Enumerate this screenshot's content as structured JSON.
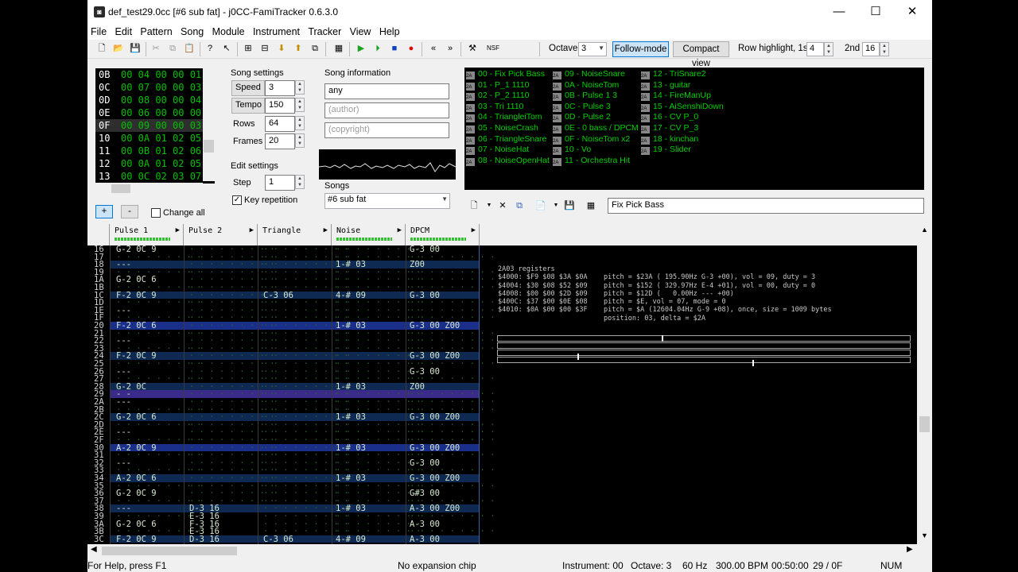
{
  "window": {
    "title": "def_test29.0cc [#6 sub fat] - j0CC-FamiTracker 0.6.3.0"
  },
  "menu": [
    "File",
    "Edit",
    "Pattern",
    "Song",
    "Module",
    "Instrument",
    "Tracker",
    "View",
    "Help"
  ],
  "toolbar": {
    "octave_label": "Octave",
    "octave_value": "3",
    "follow_mode": "Follow-mode",
    "compact_view": "Compact view",
    "row_highlight_label": "Row highlight, 1st",
    "row_highlight_1st": "4",
    "second_label": "2nd",
    "row_highlight_2nd": "16",
    "nsf_label": "NSF"
  },
  "frames": {
    "rows": [
      [
        "0B",
        "00 04 00 00 01"
      ],
      [
        "0C",
        "00 07 00 00 03"
      ],
      [
        "0D",
        "00 08 00 00 04"
      ],
      [
        "0E",
        "00 06 00 00 00"
      ],
      [
        "0F",
        "00 09 00 00 03"
      ],
      [
        "10",
        "00 0A 01 02 05"
      ],
      [
        "11",
        "00 0B 01 02 06"
      ],
      [
        "12",
        "00 0A 01 02 05"
      ],
      [
        "13",
        "00 0C 02 03 07"
      ]
    ],
    "add": "+",
    "remove": "-",
    "change_all": "Change all"
  },
  "song_settings": {
    "title": "Song settings",
    "speed_label": "Speed",
    "speed": "3",
    "tempo_label": "Tempo",
    "tempo": "150",
    "rows_label": "Rows",
    "rows": "64",
    "frames_label": "Frames",
    "frames": "20"
  },
  "edit_settings": {
    "title": "Edit settings",
    "step_label": "Step",
    "step": "1",
    "key_repetition": "Key repetition"
  },
  "song_info": {
    "title": "Song information",
    "name": "any",
    "author_placeholder": "(author)",
    "copyright_placeholder": "(copyright)"
  },
  "songs": {
    "label": "Songs",
    "selected": "#6 sub fat"
  },
  "instruments": {
    "col1": [
      "00 - Fix Pick Bass",
      "01 - P_1 1110",
      "02 - P_2 1110",
      "03 - Tri 1110",
      "04 - TriangleiTom",
      "05 - NoiseCrash",
      "06 - TriangleSnare",
      "07 - NoiseHat",
      "08 - NoiseOpenHat"
    ],
    "col2": [
      "09 - NoiseSnare",
      "0A - NoiseTom",
      "0B - Pulse 1 3",
      "0C - Pulse 3",
      "0D - Pulse 2",
      "0E - 0 bass / DPCM",
      "0F - NoiseTom x2",
      "10 - Vo",
      "11 - Orchestra Hit"
    ],
    "col3": [
      "12 - TriSnare2",
      "13 - guitar",
      "14 - FireManUp",
      "15 - AiSenshiDown",
      "16 - CV P_0",
      "17 - CV P_3",
      "18 - kinchan",
      "19 - Slider"
    ],
    "name_field": "Fix Pick Bass"
  },
  "channels": [
    "Pulse 1",
    "Pulse 2",
    "Triangle",
    "Noise",
    "DPCM"
  ],
  "pattern_rows": [
    [
      "16",
      "G-2 0C 9",
      "",
      "",
      "",
      "G-3 00"
    ],
    [
      "17",
      "",
      "",
      "",
      "",
      ""
    ],
    [
      "18",
      "---",
      "",
      "",
      "1-# 03",
      "Z00"
    ],
    [
      "19",
      "",
      "",
      "",
      "",
      ""
    ],
    [
      "1A",
      "G-2 0C 6",
      "",
      "",
      "",
      ""
    ],
    [
      "1B",
      "",
      "",
      "",
      "",
      ""
    ],
    [
      "1C",
      "F-2 0C 9",
      "",
      "C-3 06",
      "4-# 09",
      "G-3 00"
    ],
    [
      "1D",
      "",
      "",
      "",
      "",
      ""
    ],
    [
      "1E",
      "---",
      "",
      "",
      "",
      ""
    ],
    [
      "1F",
      "",
      "",
      "",
      "",
      ""
    ],
    [
      "20",
      "F-2 0C 6",
      "",
      "",
      "1-# 03",
      "G-3 00 Z00"
    ],
    [
      "21",
      "",
      "",
      "",
      "",
      ""
    ],
    [
      "22",
      "---",
      "",
      "",
      "",
      ""
    ],
    [
      "23",
      "",
      "",
      "",
      "",
      ""
    ],
    [
      "24",
      "F-2 0C 9",
      "",
      "",
      "",
      "G-3 00 Z00"
    ],
    [
      "25",
      "",
      "",
      "",
      "",
      ""
    ],
    [
      "26",
      "---",
      "",
      "",
      "",
      "G-3 00"
    ],
    [
      "27",
      "",
      "",
      "",
      "",
      ""
    ],
    [
      "28",
      "G-2 0C",
      "",
      "",
      "1-# 03",
      "Z00"
    ],
    [
      "29",
      "- -",
      "",
      "",
      "",
      ""
    ],
    [
      "2A",
      "---",
      "",
      "",
      "",
      ""
    ],
    [
      "2B",
      "",
      "",
      "",
      "",
      ""
    ],
    [
      "2C",
      "G-2 0C 6",
      "",
      "",
      "1-# 03",
      "G-3 00 Z00"
    ],
    [
      "2D",
      "",
      "",
      "",
      "",
      ""
    ],
    [
      "2E",
      "---",
      "",
      "",
      "",
      ""
    ],
    [
      "2F",
      "",
      "",
      "",
      "",
      ""
    ],
    [
      "30",
      "A-2 0C 9",
      "",
      "",
      "1-# 03",
      "G-3 00 Z00"
    ],
    [
      "31",
      "",
      "",
      "",
      "",
      ""
    ],
    [
      "32",
      "---",
      "",
      "",
      "",
      "G-3 00"
    ],
    [
      "33",
      "",
      "",
      "",
      "",
      ""
    ],
    [
      "34",
      "A-2 0C 6",
      "",
      "",
      "1-# 03",
      "G-3 00 Z00"
    ],
    [
      "35",
      "",
      "",
      "",
      "",
      ""
    ],
    [
      "36",
      "G-2 0C 9",
      "",
      "",
      "",
      "G#3 00"
    ],
    [
      "37",
      "",
      "",
      "",
      "",
      ""
    ],
    [
      "38",
      "---",
      "D-3 16",
      "",
      "1-# 03",
      "A-3 00 Z00"
    ],
    [
      "39",
      "",
      "E-3 16",
      "",
      "",
      ""
    ],
    [
      "3A",
      "G-2 0C 6",
      "F-3 16",
      "",
      "",
      "A-3 00"
    ],
    [
      "3B",
      "",
      "E-3 16",
      "",
      "",
      ""
    ],
    [
      "3C",
      "F-2 0C 9",
      "D-3 16",
      "C-3 06",
      "4-# 09",
      "A-3 00"
    ]
  ],
  "registers": {
    "title": "2A03 registers",
    "lines": [
      "$4000: $F9 $08 $3A $0A    pitch = $23A ( 195.90Hz G-3 +00), vol = 09, duty = 3",
      "$4004: $30 $08 $52 $09    pitch = $152 ( 329.97Hz E-4 +01), vol = 00, duty = 0",
      "$4008: $00 $00 $2D $09    pitch = $12D (   0.00Hz --- +00)",
      "$400C: $37 $00 $0E $08    pitch = $E, vol = 07, mode = 0",
      "$4010: $0A $00 $00 $3F    pitch = $A (12604.04Hz G-9 +08), once, size = 1009 bytes",
      "                          position: 03, delta = $2A"
    ]
  },
  "status": {
    "help": "For Help, press F1",
    "chip": "No expansion chip",
    "instrument": "Instrument: 00",
    "octave": "Octave: 3",
    "rate": "60 Hz",
    "bpm": "300.00 BPM",
    "time": "00:50:00",
    "position": "29 / 0F",
    "num": "NUM"
  }
}
